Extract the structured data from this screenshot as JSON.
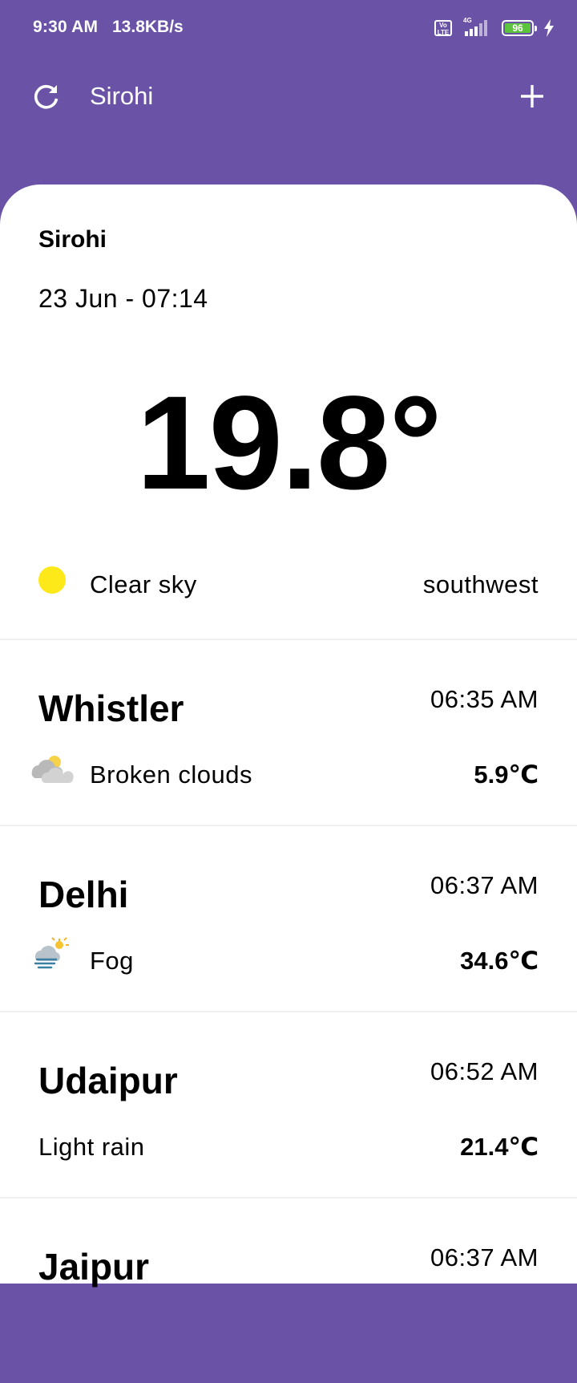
{
  "status_bar": {
    "time": "9:30 AM",
    "net_speed": "13.8KB/s",
    "volte_label": "Vo LTE",
    "network_type": "4G",
    "battery_level": "96",
    "battery_color": "#5cc33d"
  },
  "app_bar": {
    "title": "Sirohi",
    "refresh_icon": "refresh-icon",
    "add_icon": "plus-icon",
    "background_color": "#6a52a6"
  },
  "current": {
    "city": "Sirohi",
    "datetime": "23 Jun - 07:14",
    "temperature": "19.8°",
    "condition": "Clear sky",
    "condition_icon": "sun-icon",
    "wind_direction": "southwest"
  },
  "cities": [
    {
      "name": "Whistler",
      "time": "06:35 AM",
      "condition": "Broken clouds",
      "icon": "broken-clouds-icon",
      "temperature": "5.9℃"
    },
    {
      "name": "Delhi",
      "time": "06:37 AM",
      "condition": "Fog",
      "icon": "fog-icon",
      "temperature": "34.6℃"
    },
    {
      "name": "Udaipur",
      "time": "06:52 AM",
      "condition": "Light rain",
      "icon": "",
      "temperature": "21.4℃"
    },
    {
      "name": "Jaipur",
      "time": "06:37 AM",
      "condition": "",
      "icon": "",
      "temperature": ""
    }
  ]
}
